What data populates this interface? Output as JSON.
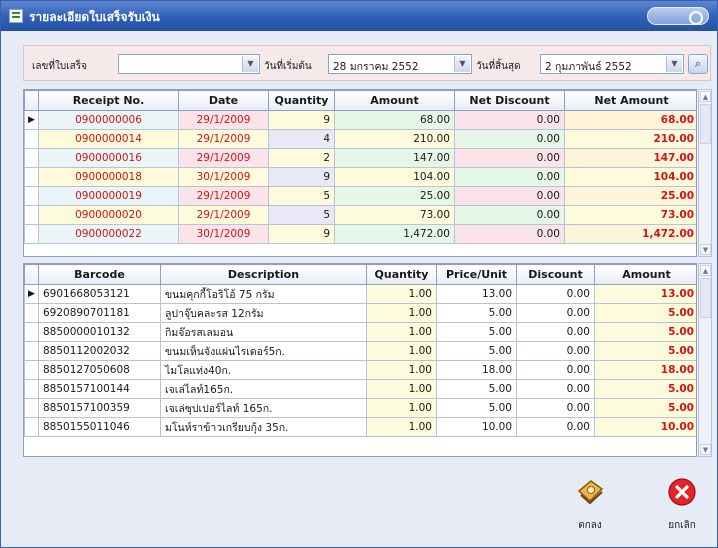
{
  "window": {
    "title": "รายละเอียดใบเสร็จรับเงิน"
  },
  "filter": {
    "receipt_label": "เลขที่ใบเสร็จ",
    "receipt_value": "",
    "start_label": "วันที่เริ่มต้น",
    "start_value": "28  มกราคม    2552",
    "end_label": "วันที่สิ้นสุด",
    "end_value": "2  กุมภาพันธ์  2552"
  },
  "receipts": {
    "headers": [
      "Receipt No.",
      "Date",
      "Quantity",
      "Amount",
      "Net Discount",
      "Net Amount"
    ],
    "rows": [
      {
        "no": "0900000006",
        "date": "29/1/2009",
        "qty": "9",
        "amount": "68.00",
        "discount": "0.00",
        "net": "68.00"
      },
      {
        "no": "0900000014",
        "date": "29/1/2009",
        "qty": "4",
        "amount": "210.00",
        "discount": "0.00",
        "net": "210.00"
      },
      {
        "no": "0900000016",
        "date": "29/1/2009",
        "qty": "2",
        "amount": "147.00",
        "discount": "0.00",
        "net": "147.00"
      },
      {
        "no": "0900000018",
        "date": "30/1/2009",
        "qty": "9",
        "amount": "104.00",
        "discount": "0.00",
        "net": "104.00"
      },
      {
        "no": "0900000019",
        "date": "29/1/2009",
        "qty": "5",
        "amount": "25.00",
        "discount": "0.00",
        "net": "25.00"
      },
      {
        "no": "0900000020",
        "date": "29/1/2009",
        "qty": "5",
        "amount": "73.00",
        "discount": "0.00",
        "net": "73.00"
      },
      {
        "no": "0900000022",
        "date": "30/1/2009",
        "qty": "9",
        "amount": "1,472.00",
        "discount": "0.00",
        "net": "1,472.00"
      }
    ]
  },
  "items": {
    "headers": [
      "Barcode",
      "Description",
      "Quantity",
      "Price/Unit",
      "Discount",
      "Amount"
    ],
    "rows": [
      {
        "barcode": "6901668053121",
        "desc": "ขนมคุกกี้โอริโอ้ 75 กรัม",
        "qty": "1.00",
        "price": "13.00",
        "discount": "0.00",
        "amount": "13.00"
      },
      {
        "barcode": "6920890701181",
        "desc": "ลูปาจุ๊บคละรส 12กรัม",
        "qty": "1.00",
        "price": "5.00",
        "discount": "0.00",
        "amount": "5.00"
      },
      {
        "barcode": "8850000010132",
        "desc": "กิมจ๊อรสเลมอน",
        "qty": "1.00",
        "price": "5.00",
        "discount": "0.00",
        "amount": "5.00"
      },
      {
        "barcode": "8850112002032",
        "desc": "ขนมเห็นจังแผ่นไรเดอร์5ก.",
        "qty": "1.00",
        "price": "5.00",
        "discount": "0.00",
        "amount": "5.00"
      },
      {
        "barcode": "8850127050608",
        "desc": "ไมโลแท่ง40ก.",
        "qty": "1.00",
        "price": "18.00",
        "discount": "0.00",
        "amount": "18.00"
      },
      {
        "barcode": "8850157100144",
        "desc": "เจเล่ไลท์165ก.",
        "qty": "1.00",
        "price": "5.00",
        "discount": "0.00",
        "amount": "5.00"
      },
      {
        "barcode": "8850157100359",
        "desc": "เจเล่ซุปเปอร์ไลท์ 165ก.",
        "qty": "1.00",
        "price": "5.00",
        "discount": "0.00",
        "amount": "5.00"
      },
      {
        "barcode": "8850155011046",
        "desc": "มโนห์ราข้าวเกรียบกุ้ง 35ก.",
        "qty": "1.00",
        "price": "10.00",
        "discount": "0.00",
        "amount": "10.00"
      }
    ]
  },
  "buttons": {
    "ok": "ตกลง",
    "cancel": "ยกเลิก"
  },
  "icons": {
    "title": "window-list-icon",
    "search": "binoculars-icon",
    "ok": "ok-tag-icon",
    "cancel": "cancel-x-icon"
  }
}
